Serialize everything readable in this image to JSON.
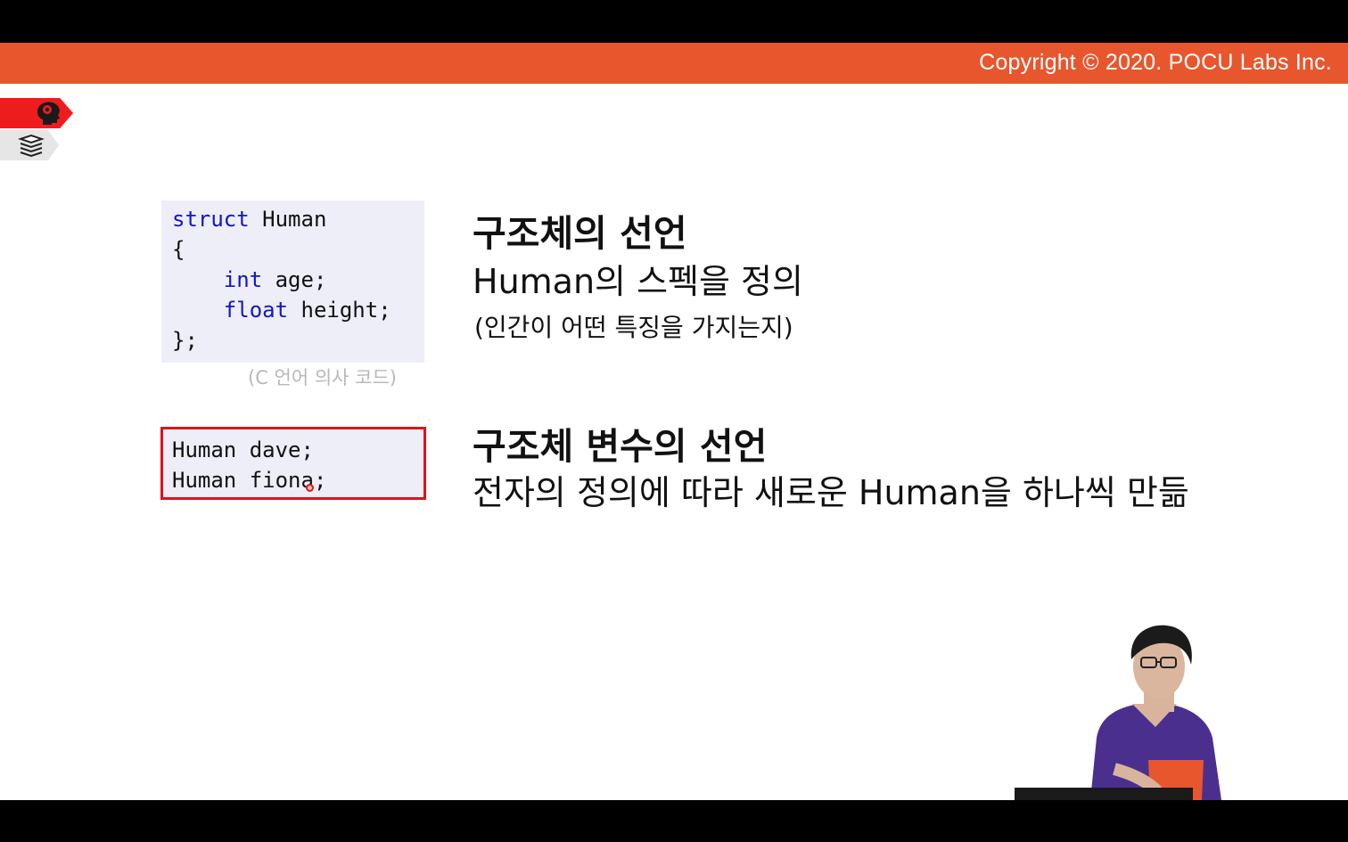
{
  "header": {
    "copyright": "Copyright © 2020. POCU Labs Inc.",
    "bar_color": "#e8562e"
  },
  "side_tabs": [
    {
      "icon": "brain-head-icon",
      "color": "#ee1c1c"
    },
    {
      "icon": "books-stack-icon",
      "color": "#e6e6e6"
    }
  ],
  "code_block_1": {
    "lines": [
      {
        "kw": "struct",
        "rest": " Human"
      },
      {
        "kw": "",
        "rest": "{"
      },
      {
        "kw": "int",
        "rest": " age;",
        "indent": "    "
      },
      {
        "kw": "float",
        "rest": " height;",
        "indent": "    "
      },
      {
        "kw": "",
        "rest": "};"
      }
    ],
    "caption": "(C 언어 의사 코드)"
  },
  "code_block_2": {
    "lines": [
      "Human dave;",
      "Human fiona;"
    ],
    "border_color": "#e0121a"
  },
  "section_1": {
    "title": "구조체의 선언",
    "subtitle": "Human의 스펙을 정의",
    "note": "(인간이 어떤 특징을 가지는지)"
  },
  "section_2": {
    "title": "구조체 변수의 선언",
    "subtitle": "전자의 정의에 따라 새로운 Human을 하나씩 만듦"
  },
  "presenter": {
    "shirt_color": "#4b2f8f"
  }
}
